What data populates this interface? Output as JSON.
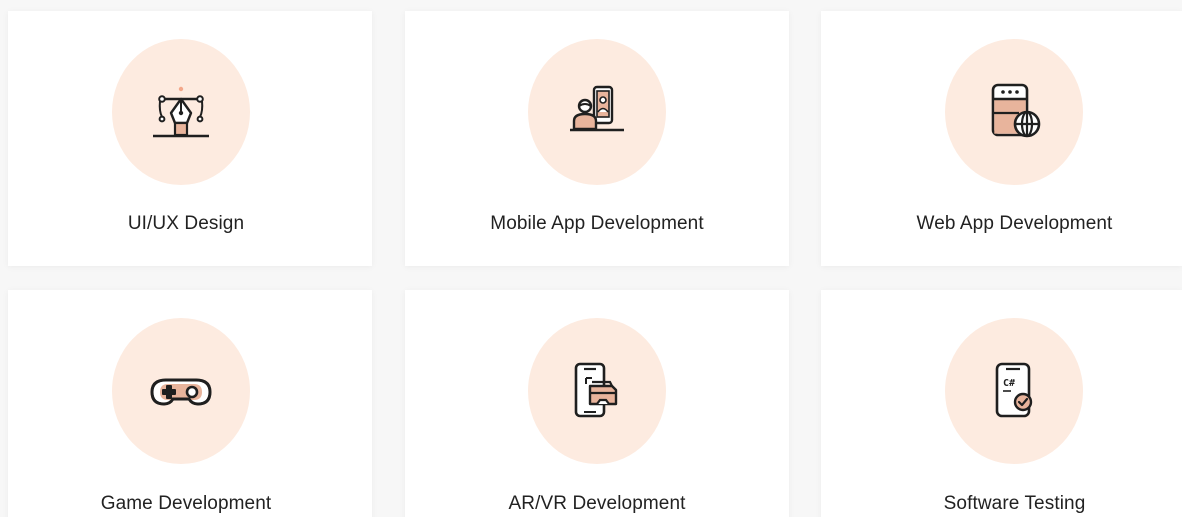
{
  "services": [
    {
      "label": "UI/UX Design",
      "icon": "pen-tool-icon"
    },
    {
      "label": "Mobile App Development",
      "icon": "mobile-video-call-icon"
    },
    {
      "label": "Web App Development",
      "icon": "web-browser-globe-icon"
    },
    {
      "label": "Game Development",
      "icon": "gamepad-icon"
    },
    {
      "label": "AR/VR Development",
      "icon": "ar-vr-headset-phone-icon"
    },
    {
      "label": "Software Testing",
      "icon": "csharp-phone-check-icon"
    }
  ],
  "colors": {
    "background": "#f7f7f7",
    "card": "#ffffff",
    "icon_circle": "#fdebe0",
    "icon_fill": "#e8b49c",
    "icon_stroke": "#1f1f1f",
    "text": "#222222"
  }
}
